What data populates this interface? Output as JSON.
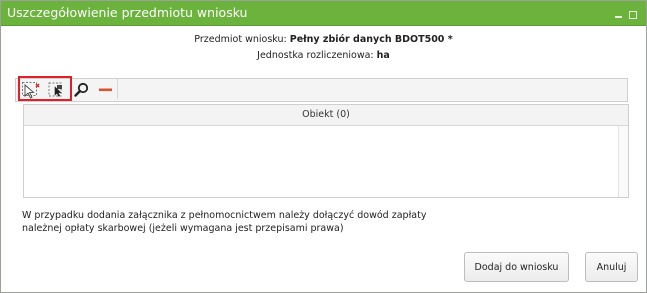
{
  "window": {
    "title": "Uszczegółowienie przedmiotu wniosku",
    "minimize_icon": "minimize-icon",
    "maximize_icon": "maximize-icon"
  },
  "info": {
    "subject_label": "Przedmiot wniosku:",
    "subject_value": "Pełny zbiór danych BDOT500 *",
    "unit_label": "Jednostka rozliczeniowa:",
    "unit_value": "ha"
  },
  "toolbar": {
    "buttons": [
      {
        "icon": "select-object-icon"
      },
      {
        "icon": "select-area-icon"
      },
      {
        "icon": "search-icon"
      },
      {
        "icon": "remove-icon"
      }
    ],
    "highlight_color": "#e01f26"
  },
  "grid": {
    "columns": [
      "Obiekt (0)"
    ],
    "rows": []
  },
  "note": {
    "line1": "W przypadku dodania załącznika z pełnomocnictwem należy dołączyć dowód zapłaty",
    "line2": "należnej opłaty skarbowej (jeżeli wymagana jest przepisami prawa)"
  },
  "actions": {
    "add_label": "Dodaj do wniosku",
    "cancel_label": "Anuluj"
  },
  "colors": {
    "titlebar": "#6cb33e",
    "remove": "#d9532b"
  }
}
